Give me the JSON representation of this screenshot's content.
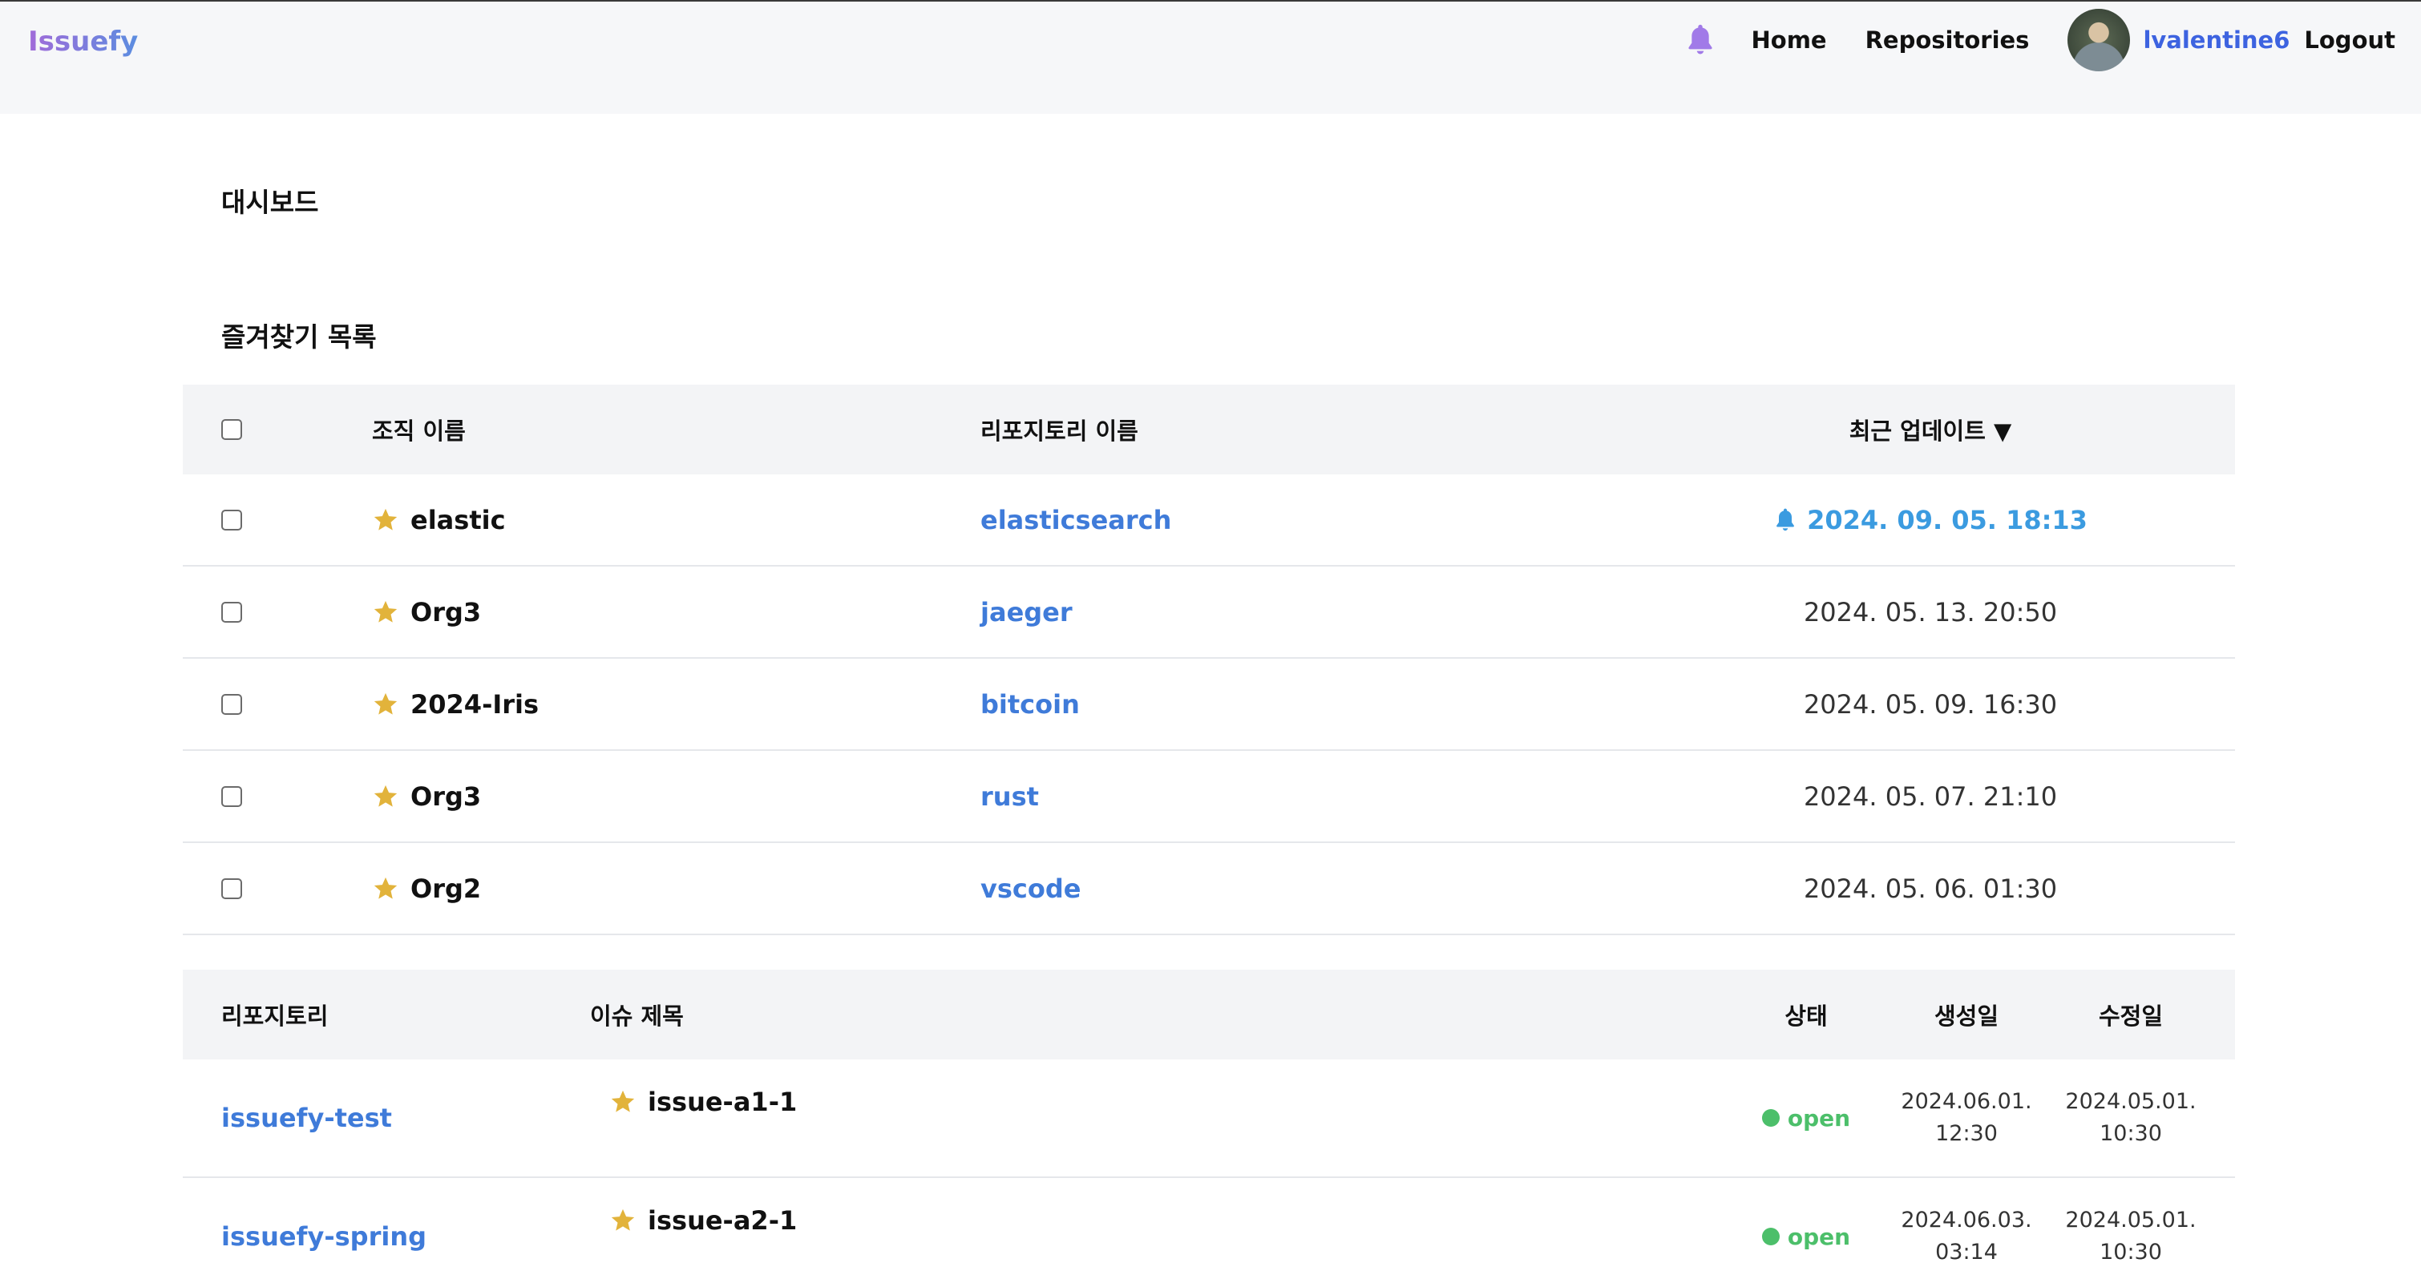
{
  "nav": {
    "brand": "Issuefy",
    "links": {
      "home": "Home",
      "repositories": "Repositories"
    },
    "username": "lvalentine6",
    "logout": "Logout"
  },
  "page": {
    "title": "대시보드",
    "favorites_title": "즐겨찾기 목록"
  },
  "favorites": {
    "headers": {
      "org": "조직 이름",
      "repo": "리포지토리 이름",
      "updated": "최근 업데이트 ▼"
    },
    "rows": [
      {
        "org": "elastic",
        "repo": "elasticsearch",
        "updated": "2024. 09. 05. 18:13",
        "highlight": true
      },
      {
        "org": "Org3",
        "repo": "jaeger",
        "updated": "2024. 05. 13. 20:50",
        "highlight": false
      },
      {
        "org": "2024-Iris",
        "repo": "bitcoin",
        "updated": "2024. 05. 09. 16:30",
        "highlight": false
      },
      {
        "org": "Org3",
        "repo": "rust",
        "updated": "2024. 05. 07. 21:10",
        "highlight": false
      },
      {
        "org": "Org2",
        "repo": "vscode",
        "updated": "2024. 05. 06. 01:30",
        "highlight": false
      }
    ]
  },
  "issues": {
    "headers": {
      "repo": "리포지토리",
      "title": "이슈 제목",
      "status": "상태",
      "created": "생성일",
      "updated": "수정일"
    },
    "rows": [
      {
        "repo": "issuefy-test",
        "title": "issue-a1-1",
        "status": "open",
        "created_date": "2024.06.01.",
        "created_time": "12:30",
        "updated_date": "2024.05.01.",
        "updated_time": "10:30"
      },
      {
        "repo": "issuefy-spring",
        "title": "issue-a2-1",
        "status": "open",
        "created_date": "2024.06.03.",
        "created_time": "03:14",
        "updated_date": "2024.05.01.",
        "updated_time": "10:30"
      }
    ]
  },
  "colors": {
    "accent": "#3f7bd9",
    "highlight_date": "#3b9be0",
    "star": "#e2b33b",
    "open": "#4cbf6a",
    "bell": "#a17ae8"
  },
  "icons": {
    "nav_bell": "bell-icon",
    "favorite_star": "star-icon",
    "row_bell": "bell-icon"
  }
}
